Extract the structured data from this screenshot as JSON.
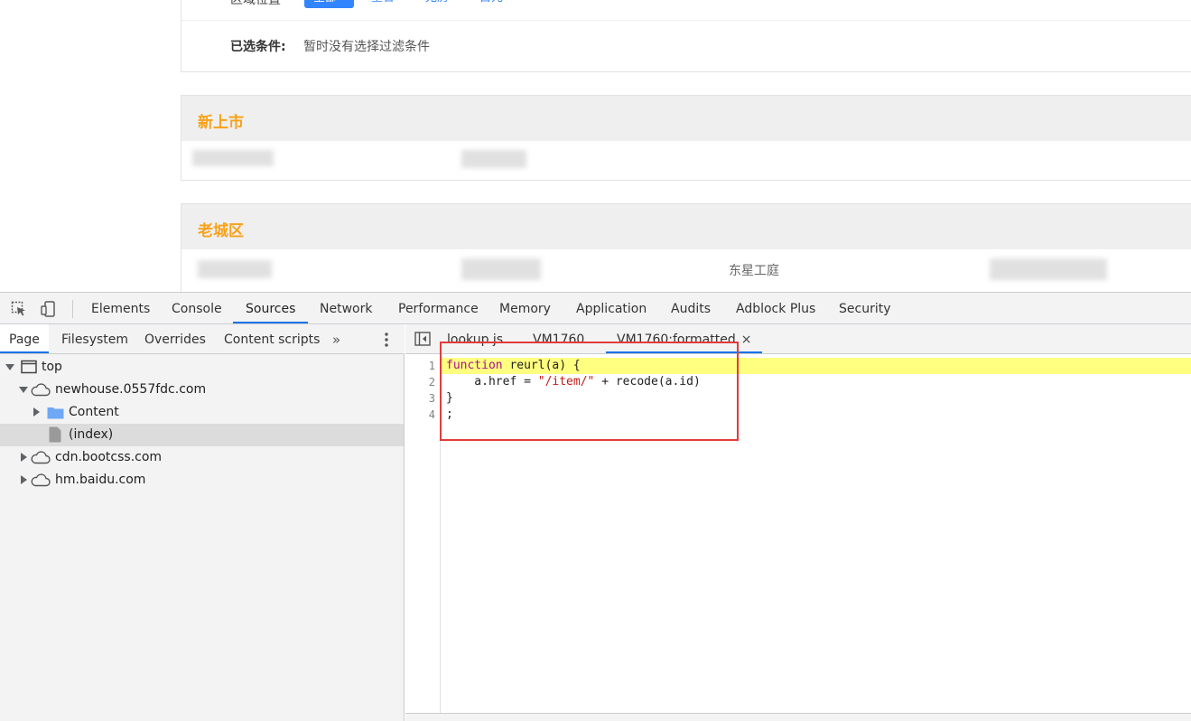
{
  "webpage": {
    "filter_top_label": "区域位置",
    "filter_pills": [
      "全部",
      "重合",
      "无房",
      "占元"
    ],
    "selected_label": "已选条件:",
    "selected_value": "暂时没有选择过滤条件",
    "blocks": [
      {
        "title": "新上市"
      },
      {
        "title": "老城区",
        "visible_item": "东星工庭"
      }
    ]
  },
  "devtools": {
    "tabs": [
      "Elements",
      "Console",
      "Sources",
      "Network",
      "Performance",
      "Memory",
      "Application",
      "Audits",
      "Adblock Plus",
      "Security"
    ],
    "active_tab": "Sources",
    "navigator": {
      "tabs": [
        "Page",
        "Filesystem",
        "Overrides",
        "Content scripts"
      ],
      "active_tab": "Page",
      "more": "»",
      "tree": [
        {
          "label": "top",
          "icon": "frame-icon",
          "level": 0,
          "expanded": true
        },
        {
          "label": "newhouse.0557fdc.com",
          "icon": "cloud-icon",
          "level": 1,
          "expanded": true
        },
        {
          "label": "Content",
          "icon": "folder-icon",
          "level": 2,
          "expanded": false
        },
        {
          "label": "(index)",
          "icon": "file-icon",
          "level": 2,
          "selected": true
        },
        {
          "label": "cdn.bootcss.com",
          "icon": "cloud-icon",
          "level": 1,
          "expanded": false
        },
        {
          "label": "hm.baidu.com",
          "icon": "cloud-icon",
          "level": 1,
          "expanded": false
        }
      ]
    },
    "editor": {
      "tabs": [
        "lookup.js",
        "VM1760",
        "VM1760:formatted"
      ],
      "active_tab": "VM1760:formatted",
      "close_glyph": "×",
      "line_numbers": [
        "1",
        "2",
        "3",
        "4"
      ],
      "code": {
        "l1_kw": "function",
        "l1_rest": " reurl(a) {",
        "l2_pre": "    a.href = ",
        "l2_str": "\"/item/\"",
        "l2_post": " + recode(a.id)",
        "l3": "}",
        "l4": ";"
      }
    }
  },
  "colors": {
    "accent_blue": "#1a73e8",
    "pill_blue": "#3385ff",
    "section_title_orange": "#f7a21b",
    "highlight_yellow": "#ffff80",
    "annotation_red": "#e23b3b"
  }
}
